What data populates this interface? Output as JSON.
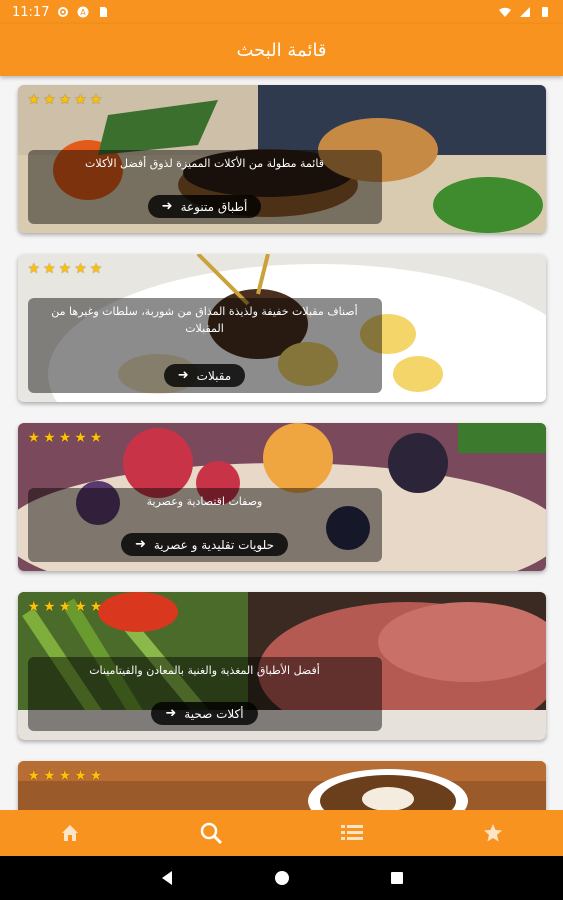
{
  "status_bar": {
    "time": "11:17"
  },
  "app_bar": {
    "title": "قائمة البحث"
  },
  "cards": [
    {
      "rating": 5,
      "description": "قائمة مطولة من الأكلات المميزة لذوق أفضل الأكلات",
      "button_label": "أطباق متنوعة"
    },
    {
      "rating": 5,
      "description": "أصناف مقبلات خفيفة ولذيذة المذاق من شوربة، سلطات وغيرها من المقبلات",
      "button_label": "مقبلات"
    },
    {
      "rating": 5,
      "description": "وصفات اقتصادية وعصرية",
      "button_label": "حلويات تقليدية و عصرية"
    },
    {
      "rating": 5,
      "description": "أفضل الأطباق المغذية والغنية بالمعادن والفيتامينات",
      "button_label": "أكلات صحية"
    },
    {
      "rating": 5,
      "description": "",
      "button_label": ""
    }
  ],
  "bottom_nav": {
    "items": [
      {
        "icon": "home-icon"
      },
      {
        "icon": "search-icon",
        "active": true
      },
      {
        "icon": "list-icon"
      },
      {
        "icon": "star-icon"
      }
    ]
  },
  "colors": {
    "primary": "#f7931e",
    "star": "#ffc107"
  }
}
